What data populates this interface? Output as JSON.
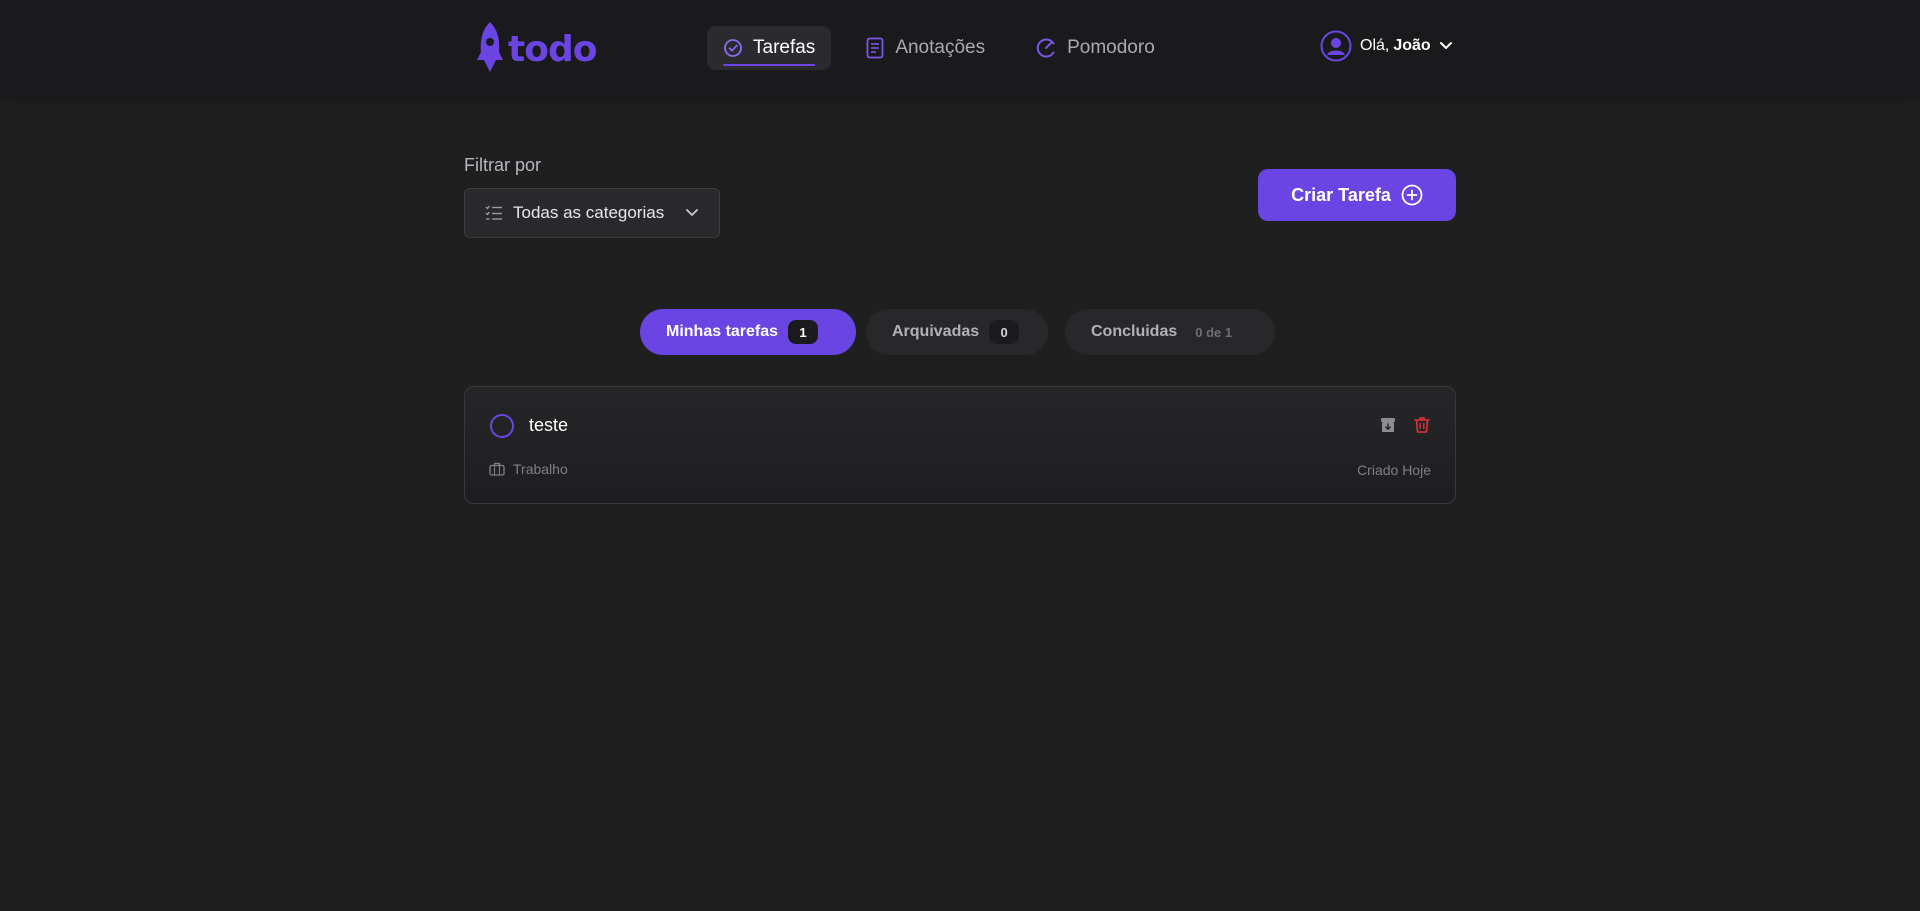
{
  "brand": {
    "name": "todo",
    "accent": "#6a45e3"
  },
  "nav": {
    "items": [
      {
        "label": "Tarefas",
        "icon": "check-circle-icon",
        "active": true
      },
      {
        "label": "Anotações",
        "icon": "notes-icon",
        "active": false
      },
      {
        "label": "Pomodoro",
        "icon": "pomodoro-icon",
        "active": false
      }
    ]
  },
  "user": {
    "greeting": "Olá,",
    "name": "João"
  },
  "filter": {
    "label": "Filtrar por",
    "selected": "Todas as categorias"
  },
  "actions": {
    "create_label": "Criar Tarefa"
  },
  "tabs": [
    {
      "label": "Minhas tarefas",
      "count": "1"
    },
    {
      "label": "Arquivadas",
      "count": "0"
    },
    {
      "label": "Concluidas",
      "count": "0 de 1"
    }
  ],
  "tasks": [
    {
      "title": "teste",
      "category": "Trabalho",
      "created": "Criado Hoje",
      "completed": false
    }
  ],
  "colors": {
    "background": "#1f1f20",
    "header": "#1a1a1c",
    "danger": "#e0313a"
  }
}
